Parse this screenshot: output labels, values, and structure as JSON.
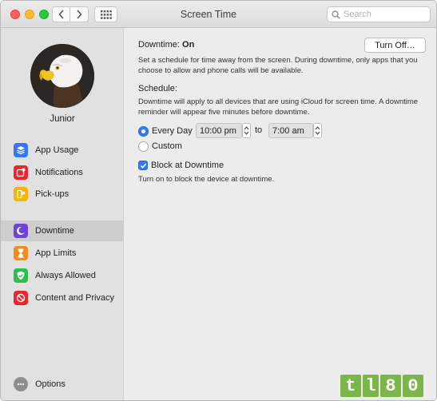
{
  "window": {
    "title": "Screen Time",
    "search": {
      "placeholder": "Search",
      "value": ""
    }
  },
  "icons": {
    "back": "chevron-left-icon",
    "forward": "chevron-right-icon",
    "grid": "grid-icon",
    "search": "search-icon"
  },
  "sidebar": {
    "username": "Junior",
    "items": [
      {
        "label": "App Usage",
        "icon": "layers-icon",
        "color": "#3478f6",
        "active": false
      },
      {
        "label": "Notifications",
        "icon": "notification-icon",
        "color": "#e8262e",
        "active": false
      },
      {
        "label": "Pick-ups",
        "icon": "pickup-arrow-icon",
        "color": "#f7b500",
        "active": false
      },
      {
        "label": "Downtime",
        "icon": "moon-clock-icon",
        "color": "#6e44d8",
        "active": true
      },
      {
        "label": "App Limits",
        "icon": "hourglass-icon",
        "color": "#f38b1f",
        "active": false
      },
      {
        "label": "Always Allowed",
        "icon": "checkmark-shield-icon",
        "color": "#2ebd4e",
        "active": false
      },
      {
        "label": "Content and Privacy",
        "icon": "no-entry-icon",
        "color": "#e8262e",
        "active": false
      }
    ],
    "options_label": "Options"
  },
  "main": {
    "downtime_label": "Downtime:",
    "downtime_state": "On",
    "turn_off_button": "Turn Off…",
    "description": "Set a schedule for time away from the screen. During downtime, only apps that you choose to allow and phone calls will be available.",
    "schedule_label": "Schedule:",
    "schedule_description": "Downtime will apply to all devices that are using iCloud for screen time. A downtime reminder will appear five minutes before downtime.",
    "every_day_label": "Every Day",
    "custom_label": "Custom",
    "start_time": "10:00 pm",
    "to_label": "to",
    "end_time": "7:00 am",
    "block_label": "Block at Downtime",
    "block_checked": true,
    "block_description": "Turn on to block the device at downtime."
  },
  "watermark": {
    "text": "tl80"
  },
  "colors": {
    "accent": "#3478f6",
    "sidebar_bg": "#e1e1e1",
    "content_bg": "#ececec",
    "watermark": "#7ab648"
  }
}
